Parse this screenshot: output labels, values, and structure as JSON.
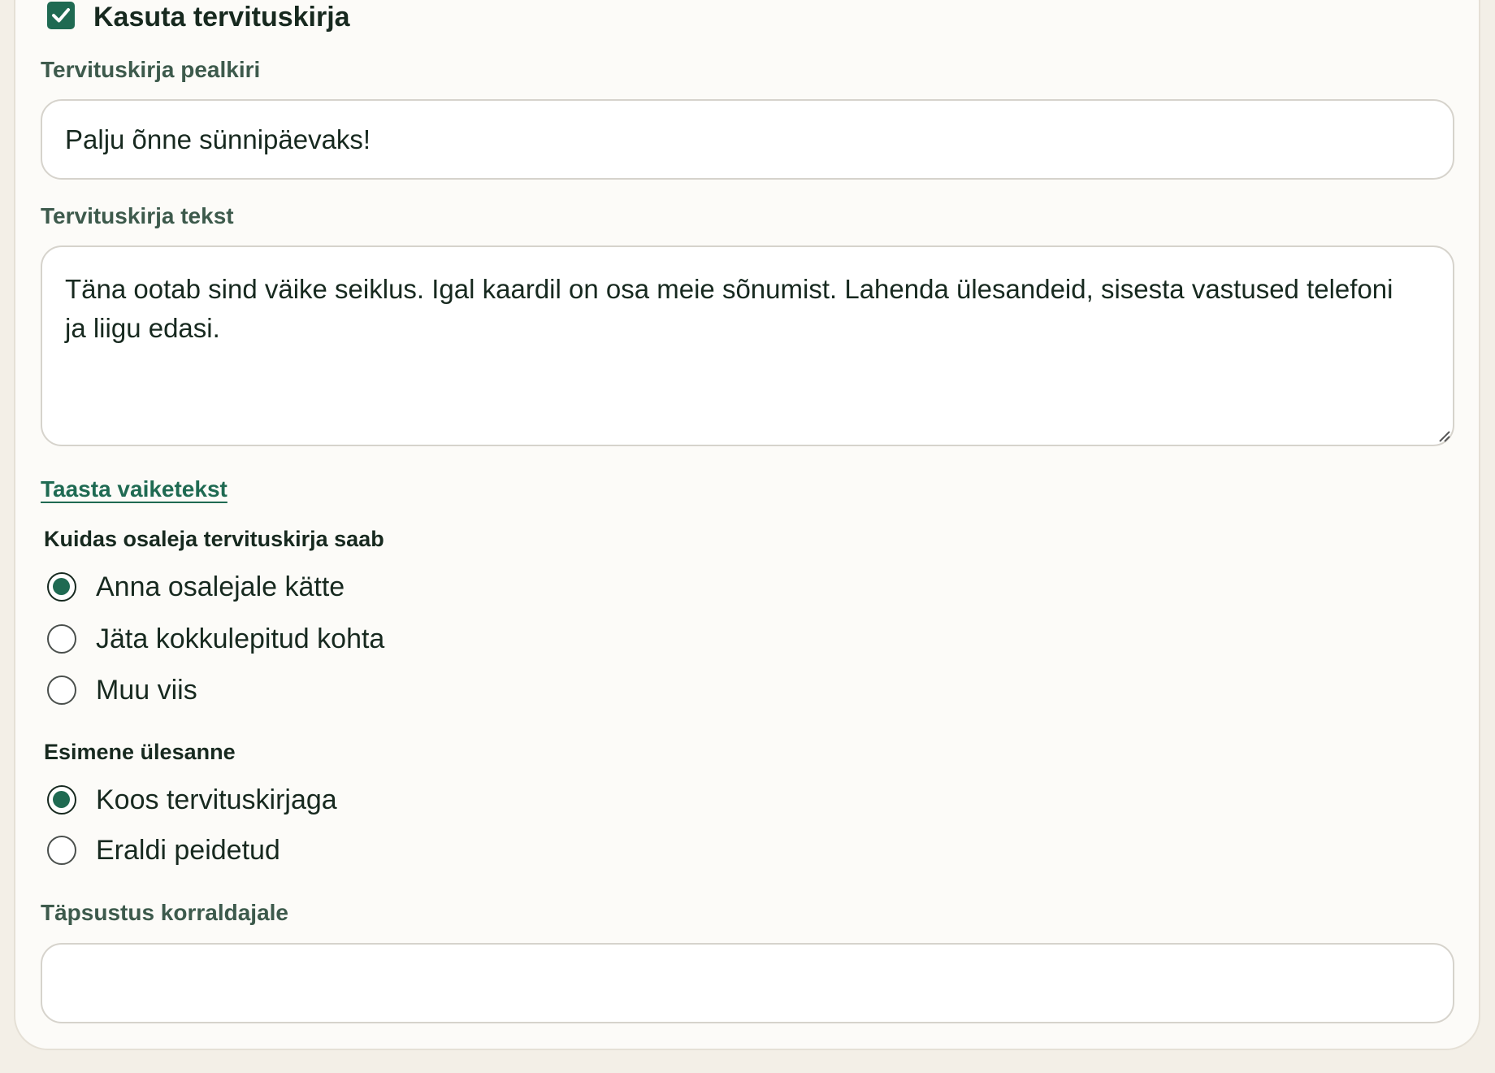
{
  "greeting_toggle": {
    "label": "Kasuta tervituskirja",
    "checked": true
  },
  "title_field": {
    "label": "Tervituskirja pealkiri",
    "value": "Palju õnne sünnipäevaks!"
  },
  "text_field": {
    "label": "Tervituskirja tekst",
    "value": "Täna ootab sind väike seiklus. Igal kaardil on osa meie sõnumist. Lahenda ülesandeid, sisesta vastused telefoni ja liigu edasi."
  },
  "reset_link": "Taasta vaiketekst",
  "delivery": {
    "label": "Kuidas osaleja tervituskirja saab",
    "selected": "Anna osalejale kätte",
    "options": [
      "Anna osalejale kätte",
      "Jäta kokkulepitud kohta",
      "Muu viis"
    ]
  },
  "first_task": {
    "label": "Esimene ülesanne",
    "selected": "Koos tervituskirjaga",
    "options": [
      "Koos tervituskirjaga",
      "Eraldi peidetud"
    ]
  },
  "organizer_note": {
    "label": "Täpsustus korraldajale",
    "value": ""
  },
  "colors": {
    "accent": "#1f6a52",
    "page_background": "#f3efe7",
    "card_background": "#fcfbf8",
    "text": "#17291f",
    "label_text": "#3d5a4c"
  },
  "icons": {
    "checkbox": "check-icon",
    "textarea_corner": "resize-handle-icon"
  }
}
